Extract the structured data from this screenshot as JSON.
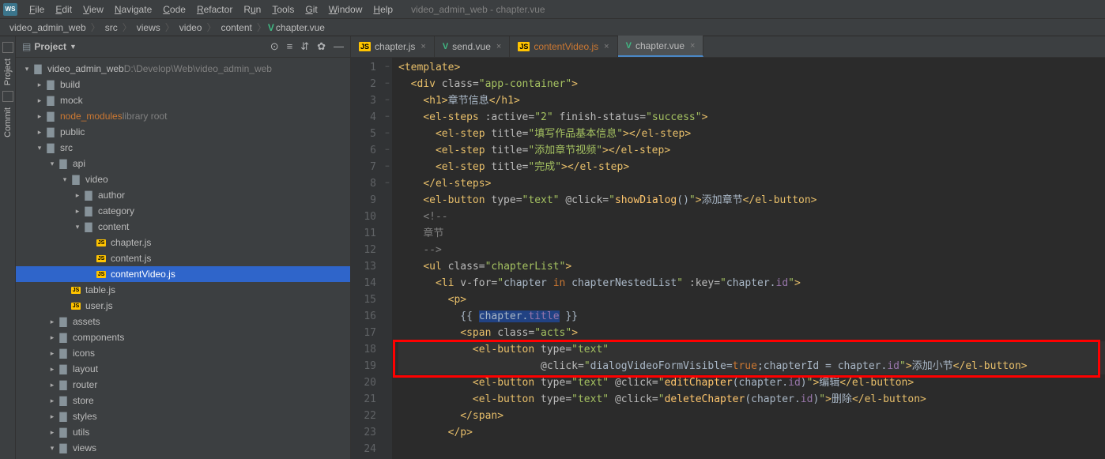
{
  "window_title": "video_admin_web - chapter.vue",
  "menu": [
    "File",
    "Edit",
    "View",
    "Navigate",
    "Code",
    "Refactor",
    "Run",
    "Tools",
    "Git",
    "Window",
    "Help"
  ],
  "breadcrumb": [
    "video_admin_web",
    "src",
    "views",
    "video",
    "content"
  ],
  "breadcrumb_file": "chapter.vue",
  "sidebar": {
    "title": "Project",
    "tree": [
      {
        "d": 0,
        "a": "v",
        "i": "folder",
        "l": "video_admin_web",
        "h": "D:\\Develop\\Web\\video_admin_web"
      },
      {
        "d": 1,
        "a": ">",
        "i": "folder",
        "l": "build"
      },
      {
        "d": 1,
        "a": ">",
        "i": "folder",
        "l": "mock"
      },
      {
        "d": 1,
        "a": ">",
        "i": "folder",
        "l": "node_modules",
        "h": "library root",
        "cls": "orange"
      },
      {
        "d": 1,
        "a": ">",
        "i": "folder",
        "l": "public"
      },
      {
        "d": 1,
        "a": "v",
        "i": "folder",
        "l": "src"
      },
      {
        "d": 2,
        "a": "v",
        "i": "folder",
        "l": "api"
      },
      {
        "d": 3,
        "a": "v",
        "i": "folder",
        "l": "video"
      },
      {
        "d": 4,
        "a": ">",
        "i": "folder",
        "l": "author"
      },
      {
        "d": 4,
        "a": ">",
        "i": "folder",
        "l": "category"
      },
      {
        "d": 4,
        "a": "v",
        "i": "folder",
        "l": "content"
      },
      {
        "d": 5,
        "a": "",
        "i": "js",
        "l": "chapter.js"
      },
      {
        "d": 5,
        "a": "",
        "i": "js",
        "l": "content.js"
      },
      {
        "d": 5,
        "a": "",
        "i": "js",
        "l": "contentVideo.js",
        "sel": true,
        "cls": "teal"
      },
      {
        "d": 3,
        "a": "",
        "i": "js",
        "l": "table.js"
      },
      {
        "d": 3,
        "a": "",
        "i": "js",
        "l": "user.js"
      },
      {
        "d": 2,
        "a": ">",
        "i": "folder",
        "l": "assets"
      },
      {
        "d": 2,
        "a": ">",
        "i": "folder",
        "l": "components"
      },
      {
        "d": 2,
        "a": ">",
        "i": "folder",
        "l": "icons"
      },
      {
        "d": 2,
        "a": ">",
        "i": "folder",
        "l": "layout"
      },
      {
        "d": 2,
        "a": ">",
        "i": "folder",
        "l": "router"
      },
      {
        "d": 2,
        "a": ">",
        "i": "folder",
        "l": "store"
      },
      {
        "d": 2,
        "a": ">",
        "i": "folder",
        "l": "styles"
      },
      {
        "d": 2,
        "a": ">",
        "i": "folder",
        "l": "utils"
      },
      {
        "d": 2,
        "a": "v",
        "i": "folder",
        "l": "views"
      }
    ]
  },
  "tabs": [
    {
      "icon": "js",
      "label": "chapter.js"
    },
    {
      "icon": "vue",
      "label": "send.vue"
    },
    {
      "icon": "js",
      "label": "contentVideo.js",
      "orange": true
    },
    {
      "icon": "vue",
      "label": "chapter.vue",
      "active": true
    }
  ],
  "rails": [
    "Project",
    "Commit"
  ],
  "line_count": 24
}
